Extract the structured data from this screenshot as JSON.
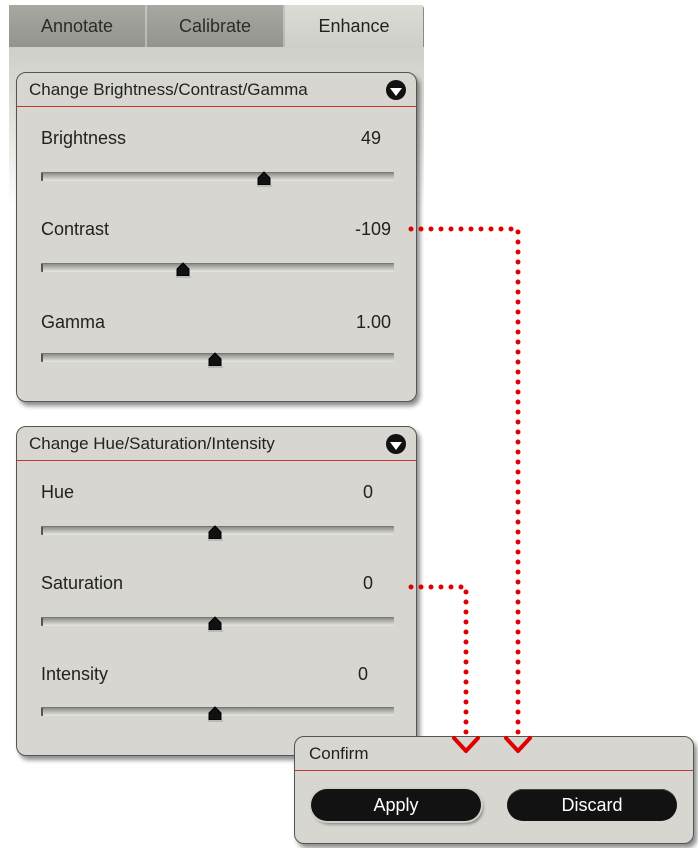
{
  "tabs": [
    {
      "label": "Annotate",
      "active": false
    },
    {
      "label": "Calibrate",
      "active": false
    },
    {
      "label": "Enhance",
      "active": true
    }
  ],
  "bcg_panel": {
    "title": "Change Brightness/Contrast/Gamma",
    "toggle_icon": "chevron-down-icon",
    "rows": [
      {
        "label": "Brightness",
        "value": "49",
        "slider_fraction": 0.63
      },
      {
        "label": "Contrast",
        "value": "-109",
        "slider_fraction": 0.4
      },
      {
        "label": "Gamma",
        "value": "1.00",
        "slider_fraction": 0.49
      }
    ]
  },
  "hsi_panel": {
    "title": "Change Hue/Saturation/Intensity",
    "toggle_icon": "chevron-down-icon",
    "rows": [
      {
        "label": "Hue",
        "value": "0",
        "slider_fraction": 0.49
      },
      {
        "label": "Saturation",
        "value": "0",
        "slider_fraction": 0.49
      },
      {
        "label": "Intensity",
        "value": "0",
        "slider_fraction": 0.49
      }
    ]
  },
  "confirm_panel": {
    "title": "Confirm",
    "apply_label": "Apply",
    "discard_label": "Discard"
  },
  "colors": {
    "panel_bg": "#d7d6d0",
    "header_rule": "#c0392b",
    "connector": "#e00000",
    "button_bg": "#121212"
  }
}
